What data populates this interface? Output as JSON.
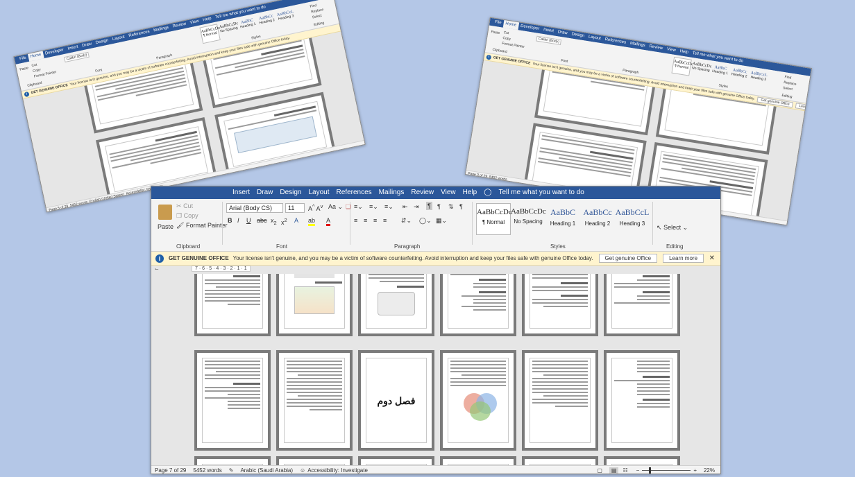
{
  "app": {
    "tabs_main": [
      "Insert",
      "Draw",
      "Design",
      "Layout",
      "References",
      "Mailings",
      "Review",
      "View",
      "Help"
    ],
    "tabs_small": [
      "File",
      "Home",
      "Developer",
      "Insert",
      "Draw",
      "Design",
      "Layout",
      "References",
      "Mailings",
      "Review",
      "View",
      "Help"
    ],
    "tell_me": "Tell me what you want to do",
    "clipboard": {
      "paste": "Paste",
      "cut": "Cut",
      "copy": "Copy",
      "format_painter": "Format Painter",
      "label": "Clipboard"
    },
    "font": {
      "name": "Arial (Body CS)",
      "size": "11",
      "label": "Font",
      "name_small": "Calibri (Body)"
    },
    "paragraph": {
      "label": "Paragraph"
    },
    "styles": {
      "label": "Styles",
      "items": [
        {
          "preview": "AaBbCcDc",
          "name": "¶ Normal"
        },
        {
          "preview": "AaBbCcDc",
          "name": "No Spacing"
        },
        {
          "preview": "AaBbC",
          "name": "Heading 1"
        },
        {
          "preview": "AaBbCc",
          "name": "Heading 2"
        },
        {
          "preview": "AaBbCcL",
          "name": "Heading 3"
        }
      ],
      "small_items": [
        {
          "preview": "AaBbCcDc",
          "name": "¶ Normal"
        },
        {
          "preview": "AaBbCcDc",
          "name": "No Spacing"
        },
        {
          "preview": "AaBbC",
          "name": "Heading 1"
        },
        {
          "preview": "AaBbCc",
          "name": "Heading 2"
        },
        {
          "preview": "AaBbCcL",
          "name": "Heading 3"
        }
      ]
    },
    "editing": {
      "label": "Editing",
      "select": "Select",
      "find": "Find",
      "replace": "Replace"
    },
    "banner": {
      "title": "GET GENUINE OFFICE",
      "message": "Your license isn't genuine, and you may be a victim of software counterfeiting. Avoid interruption and keep your files safe with genuine Office today.",
      "btn_genuine": "Get genuine Office",
      "btn_learn": "Learn more"
    },
    "ruler": "7 · 6 · 5 · 4 · 3 · 2 · 1 · 1",
    "status": {
      "page": "Page 7 of 29",
      "words": "5452 words",
      "language": "Arabic (Saudi Arabia)",
      "accessibility": "Accessibility: Investigate",
      "zoom": "22%",
      "small_page_a": "Page 5 of 29",
      "small_page_b": "Page 3 of 29",
      "small_language": "English (United States)"
    },
    "chapter_heading": "فصل دوم"
  },
  "colors": {
    "word_blue": "#2b579a",
    "banner_bg": "#fff4ce",
    "desktop": "#b4c7e7"
  }
}
